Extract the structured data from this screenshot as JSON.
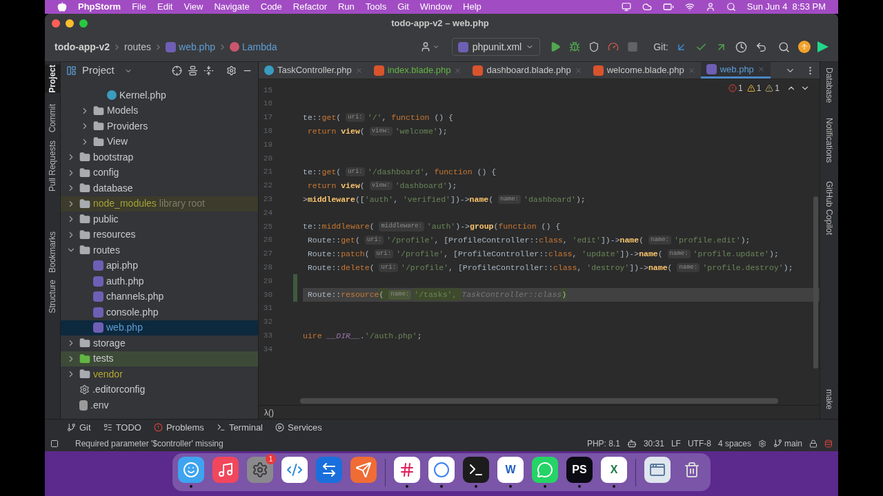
{
  "menubar": {
    "app": "PhpStorm",
    "menus": [
      "File",
      "Edit",
      "View",
      "Navigate",
      "Code",
      "Refactor",
      "Run",
      "Tools",
      "Git",
      "Window",
      "Help"
    ],
    "clock": "Sun Jun 4  8:53 PM"
  },
  "window": {
    "title": "todo-app-v2 – web.php"
  },
  "breadcrumbs": [
    {
      "label": "todo-app-v2",
      "kind": "project"
    },
    {
      "label": "routes",
      "kind": "folder"
    },
    {
      "label": "web.php",
      "kind": "php"
    },
    {
      "label": "Lambda",
      "kind": "lambda"
    }
  ],
  "run_config": "phpunit.xml",
  "git_label": "Git:",
  "toolbar": [
    {
      "kind": "run",
      "disabled": false
    },
    {
      "kind": "debug",
      "disabled": false
    },
    {
      "kind": "coverage",
      "disabled": false
    },
    {
      "kind": "profile",
      "disabled": false
    },
    {
      "kind": "stop",
      "disabled": true
    }
  ],
  "git_actions": [
    {
      "kind": "update"
    },
    {
      "kind": "commit"
    },
    {
      "kind": "push"
    },
    {
      "kind": "history"
    },
    {
      "kind": "rollback"
    }
  ],
  "left_stripe": [
    {
      "label": "Project",
      "selected": true
    },
    {
      "label": "Commit",
      "selected": false
    },
    {
      "label": "Pull Requests",
      "selected": false
    },
    {
      "label": "Bookmarks",
      "selected": false
    },
    {
      "label": "Structure",
      "selected": false
    }
  ],
  "right_stripe": [
    "Database",
    "Notifications",
    "GitHub Copilot",
    "make"
  ],
  "project_panel": {
    "title": "Project",
    "tree": [
      {
        "children": [
          {
            "children": [
              {
                "label": "Kernel.php",
                "kind": "class",
                "selected": false
              }
            ]
          },
          {
            "label": "Models",
            "kind": "folder",
            "expanded": false,
            "selected": false
          },
          {
            "label": "Providers",
            "kind": "folder",
            "expanded": false,
            "selected": false
          },
          {
            "label": "View",
            "kind": "folder",
            "expanded": false,
            "selected": false
          }
        ]
      },
      {
        "label": "bootstrap",
        "kind": "folder",
        "expanded": false,
        "selected": false
      },
      {
        "label": "config",
        "kind": "folder",
        "expanded": false,
        "selected": false
      },
      {
        "label": "database",
        "kind": "folder",
        "expanded": false,
        "selected": false
      },
      {
        "label": "node_modules",
        "note": "library root",
        "kind": "excluded",
        "expanded": false,
        "selected": false
      },
      {
        "label": "public",
        "kind": "folder",
        "expanded": false,
        "selected": false
      },
      {
        "label": "resources",
        "kind": "folder",
        "expanded": false,
        "selected": false
      },
      {
        "label": "routes",
        "kind": "folder",
        "expanded": true,
        "selected": false,
        "children": [
          {
            "label": "api.php",
            "kind": "php",
            "selected": false
          },
          {
            "label": "auth.php",
            "kind": "php",
            "selected": false
          },
          {
            "label": "channels.php",
            "kind": "php",
            "selected": false
          },
          {
            "label": "console.php",
            "kind": "php",
            "selected": false
          },
          {
            "label": "web.php",
            "kind": "php",
            "selected": true
          }
        ]
      },
      {
        "label": "storage",
        "kind": "folder",
        "expanded": false,
        "selected": false
      },
      {
        "label": "tests",
        "kind": "tests",
        "expanded": false,
        "selected": false
      },
      {
        "label": "vendor",
        "kind": "vendor",
        "expanded": false,
        "selected": false
      },
      {
        "label": ".editorconfig",
        "kind": "config",
        "selected": false
      },
      {
        "label": ".env",
        "kind": "env",
        "selected": false
      }
    ]
  },
  "tabs": [
    {
      "label": "TaskController.php",
      "kind": "class",
      "color": "#c8c8c8",
      "selected": false
    },
    {
      "label": "index.blade.php",
      "kind": "blade",
      "color": "#62b543",
      "selected": false
    },
    {
      "label": "dashboard.blade.php",
      "kind": "blade",
      "color": "#c8c8c8",
      "selected": false
    },
    {
      "label": "welcome.blade.php",
      "kind": "blade",
      "color": "#c8c8c8",
      "selected": false
    },
    {
      "label": "web.php",
      "kind": "php",
      "color": "#5e9ed6",
      "selected": true
    }
  ],
  "inspections": [
    {
      "kind": "error",
      "count": "1"
    },
    {
      "kind": "warning",
      "count": "1"
    },
    {
      "kind": "weak",
      "count": "1"
    }
  ],
  "code": [
    {
      "number": "15",
      "current": false,
      "changed": false
    },
    {
      "number": "16",
      "current": false,
      "changed": false
    },
    {
      "number": "17",
      "current": false,
      "changed": false,
      "segments": [
        {
          "kind": "plain",
          "t": "te::"
        },
        {
          "kind": "kw",
          "t": "get"
        },
        {
          "kind": "plain",
          "t": "( "
        },
        {
          "kind": "hint",
          "t": "uri:"
        },
        {
          "kind": "str",
          "t": "'/'"
        },
        {
          "kind": "plain",
          "t": ", "
        },
        {
          "kind": "kw",
          "t": "function"
        },
        {
          "kind": "plain",
          "t": " () {"
        }
      ]
    },
    {
      "number": "18",
      "current": false,
      "changed": false,
      "segments": [
        {
          "kind": "kw",
          "t": " return "
        },
        {
          "kind": "fn",
          "t": "view"
        },
        {
          "kind": "plain",
          "t": "( "
        },
        {
          "kind": "hint",
          "t": "view:"
        },
        {
          "kind": "str",
          "t": "'welcome'"
        },
        {
          "kind": "plain",
          "t": ");"
        }
      ]
    },
    {
      "number": "19",
      "current": false,
      "changed": false
    },
    {
      "number": "20",
      "current": false,
      "changed": false
    },
    {
      "number": "21",
      "current": false,
      "changed": false,
      "segments": [
        {
          "kind": "plain",
          "t": "te::"
        },
        {
          "kind": "kw",
          "t": "get"
        },
        {
          "kind": "plain",
          "t": "( "
        },
        {
          "kind": "hint",
          "t": "uri:"
        },
        {
          "kind": "str",
          "t": "'/dashboard'"
        },
        {
          "kind": "plain",
          "t": ", "
        },
        {
          "kind": "kw",
          "t": "function"
        },
        {
          "kind": "plain",
          "t": " () {"
        }
      ]
    },
    {
      "number": "22",
      "current": false,
      "changed": false,
      "segments": [
        {
          "kind": "kw",
          "t": " return "
        },
        {
          "kind": "fn",
          "t": "view"
        },
        {
          "kind": "plain",
          "t": "( "
        },
        {
          "kind": "hint",
          "t": "view:"
        },
        {
          "kind": "str",
          "t": "'dashboard'"
        },
        {
          "kind": "plain",
          "t": ");"
        }
      ]
    },
    {
      "number": "23",
      "current": false,
      "changed": false,
      "segments": [
        {
          "kind": "plain",
          "t": ">"
        },
        {
          "kind": "fn",
          "t": "middleware"
        },
        {
          "kind": "plain",
          "t": "(["
        },
        {
          "kind": "str",
          "t": "'auth'"
        },
        {
          "kind": "plain",
          "t": ", "
        },
        {
          "kind": "str",
          "t": "'verified'"
        },
        {
          "kind": "plain",
          "t": "])->"
        },
        {
          "kind": "fn",
          "t": "name"
        },
        {
          "kind": "plain",
          "t": "( "
        },
        {
          "kind": "hint",
          "t": "name:"
        },
        {
          "kind": "str",
          "t": "'dashboard'"
        },
        {
          "kind": "plain",
          "t": ");"
        }
      ]
    },
    {
      "number": "24",
      "current": false,
      "changed": false
    },
    {
      "number": "25",
      "current": false,
      "changed": false,
      "segments": [
        {
          "kind": "plain",
          "t": "te::"
        },
        {
          "kind": "kw",
          "t": "middleware"
        },
        {
          "kind": "plain",
          "t": "( "
        },
        {
          "kind": "hint",
          "t": "middleware:"
        },
        {
          "kind": "str",
          "t": "'auth'"
        },
        {
          "kind": "plain",
          "t": ")->"
        },
        {
          "kind": "fn",
          "t": "group"
        },
        {
          "kind": "plain",
          "t": "("
        },
        {
          "kind": "kw",
          "t": "function"
        },
        {
          "kind": "plain",
          "t": " () {"
        }
      ]
    },
    {
      "number": "26",
      "current": false,
      "changed": false,
      "segments": [
        {
          "kind": "plain",
          "t": " Route::"
        },
        {
          "kind": "kw",
          "t": "get"
        },
        {
          "kind": "plain",
          "t": "( "
        },
        {
          "kind": "hint",
          "t": "uri:"
        },
        {
          "kind": "str",
          "t": "'/profile'"
        },
        {
          "kind": "plain",
          "t": ", [ProfileController::"
        },
        {
          "kind": "kw",
          "t": "class"
        },
        {
          "kind": "plain",
          "t": ", "
        },
        {
          "kind": "str",
          "t": "'edit'"
        },
        {
          "kind": "plain",
          "t": "])->"
        },
        {
          "kind": "fn",
          "t": "name"
        },
        {
          "kind": "plain",
          "t": "( "
        },
        {
          "kind": "hint",
          "t": "name:"
        },
        {
          "kind": "str",
          "t": "'profile.edit'"
        },
        {
          "kind": "plain",
          "t": ");"
        }
      ]
    },
    {
      "number": "27",
      "current": false,
      "changed": false,
      "segments": [
        {
          "kind": "plain",
          "t": " Route::"
        },
        {
          "kind": "kw",
          "t": "patch"
        },
        {
          "kind": "plain",
          "t": "( "
        },
        {
          "kind": "hint",
          "t": "uri:"
        },
        {
          "kind": "str",
          "t": "'/profile'"
        },
        {
          "kind": "plain",
          "t": ", [ProfileController::"
        },
        {
          "kind": "kw",
          "t": "class"
        },
        {
          "kind": "plain",
          "t": ", "
        },
        {
          "kind": "str",
          "t": "'update'"
        },
        {
          "kind": "plain",
          "t": "])->"
        },
        {
          "kind": "fn",
          "t": "name"
        },
        {
          "kind": "plain",
          "t": "( "
        },
        {
          "kind": "hint",
          "t": "name:"
        },
        {
          "kind": "str",
          "t": "'profile.update'"
        },
        {
          "kind": "plain",
          "t": ");"
        }
      ]
    },
    {
      "number": "28",
      "current": false,
      "changed": false,
      "segments": [
        {
          "kind": "plain",
          "t": " Route::"
        },
        {
          "kind": "kw",
          "t": "delete"
        },
        {
          "kind": "plain",
          "t": "( "
        },
        {
          "kind": "hint",
          "t": "uri:"
        },
        {
          "kind": "str",
          "t": "'/profile'"
        },
        {
          "kind": "plain",
          "t": ", [ProfileController::"
        },
        {
          "kind": "kw",
          "t": "class"
        },
        {
          "kind": "plain",
          "t": ", "
        },
        {
          "kind": "str",
          "t": "'destroy'"
        },
        {
          "kind": "plain",
          "t": "])->"
        },
        {
          "kind": "fn",
          "t": "name"
        },
        {
          "kind": "plain",
          "t": "( "
        },
        {
          "kind": "hint",
          "t": "name:"
        },
        {
          "kind": "str",
          "t": "'profile.destroy'"
        },
        {
          "kind": "plain",
          "t": ");"
        }
      ]
    },
    {
      "number": "29",
      "current": false,
      "changed": true
    },
    {
      "number": "30",
      "current": true,
      "changed": true,
      "segments": [
        {
          "kind": "plain",
          "t": " Route::"
        },
        {
          "kind": "kw",
          "t": "resource"
        },
        {
          "kind": "hl",
          "t": "( "
        },
        {
          "kind": "hl-hint",
          "t": "name:"
        },
        {
          "kind": "hl-str",
          "t": "'/tasks', "
        },
        {
          "kind": "dim",
          "t": "TaskController::class"
        },
        {
          "kind": "hl",
          "t": ")"
        }
      ]
    },
    {
      "number": "31",
      "current": false,
      "changed": false
    },
    {
      "number": "32",
      "current": false,
      "changed": false
    },
    {
      "number": "33",
      "current": false,
      "changed": false,
      "segments": [
        {
          "kind": "kw",
          "t": "uire "
        },
        {
          "kind": "const",
          "t": "__DIR__"
        },
        {
          "kind": "plain",
          "t": "."
        },
        {
          "kind": "str",
          "t": "'/auth.php'"
        },
        {
          "kind": "plain",
          "t": ";"
        }
      ]
    },
    {
      "number": "34",
      "current": false,
      "changed": false
    }
  ],
  "editor_breadcrumb": "λ()",
  "tool_windows": [
    {
      "label": "Git",
      "kind": "git"
    },
    {
      "label": "TODO",
      "kind": "todo"
    },
    {
      "label": "Problems",
      "kind": "problems"
    },
    {
      "label": "Terminal",
      "kind": "terminal"
    },
    {
      "label": "Services",
      "kind": "services"
    }
  ],
  "status_bar": {
    "message": "Required parameter '$controller' missing",
    "php": "PHP: 8.1",
    "position": "30:31",
    "line_sep": "LF",
    "encoding": "UTF-8",
    "indent": "4 spaces",
    "branch": "main"
  },
  "dock": [
    {
      "kind": "finder",
      "running": true
    },
    {
      "kind": "music",
      "running": false
    },
    {
      "kind": "settings",
      "running": false,
      "badge": "1"
    },
    {
      "kind": "vscode",
      "running": false
    },
    {
      "kind": "teamviewer",
      "running": false
    },
    {
      "kind": "postman",
      "running": false
    },
    {
      "kind": "separator"
    },
    {
      "kind": "slack",
      "running": true
    },
    {
      "kind": "chrome",
      "running": true
    },
    {
      "kind": "terminal",
      "running": true
    },
    {
      "kind": "word",
      "running": true,
      "glyph": "W"
    },
    {
      "kind": "whatsapp",
      "running": true
    },
    {
      "kind": "phpstorm",
      "running": true,
      "glyph": "PS"
    },
    {
      "kind": "excel",
      "running": true,
      "glyph": "X"
    },
    {
      "kind": "separator"
    },
    {
      "kind": "window",
      "running": false
    },
    {
      "kind": "trash",
      "running": false
    }
  ]
}
